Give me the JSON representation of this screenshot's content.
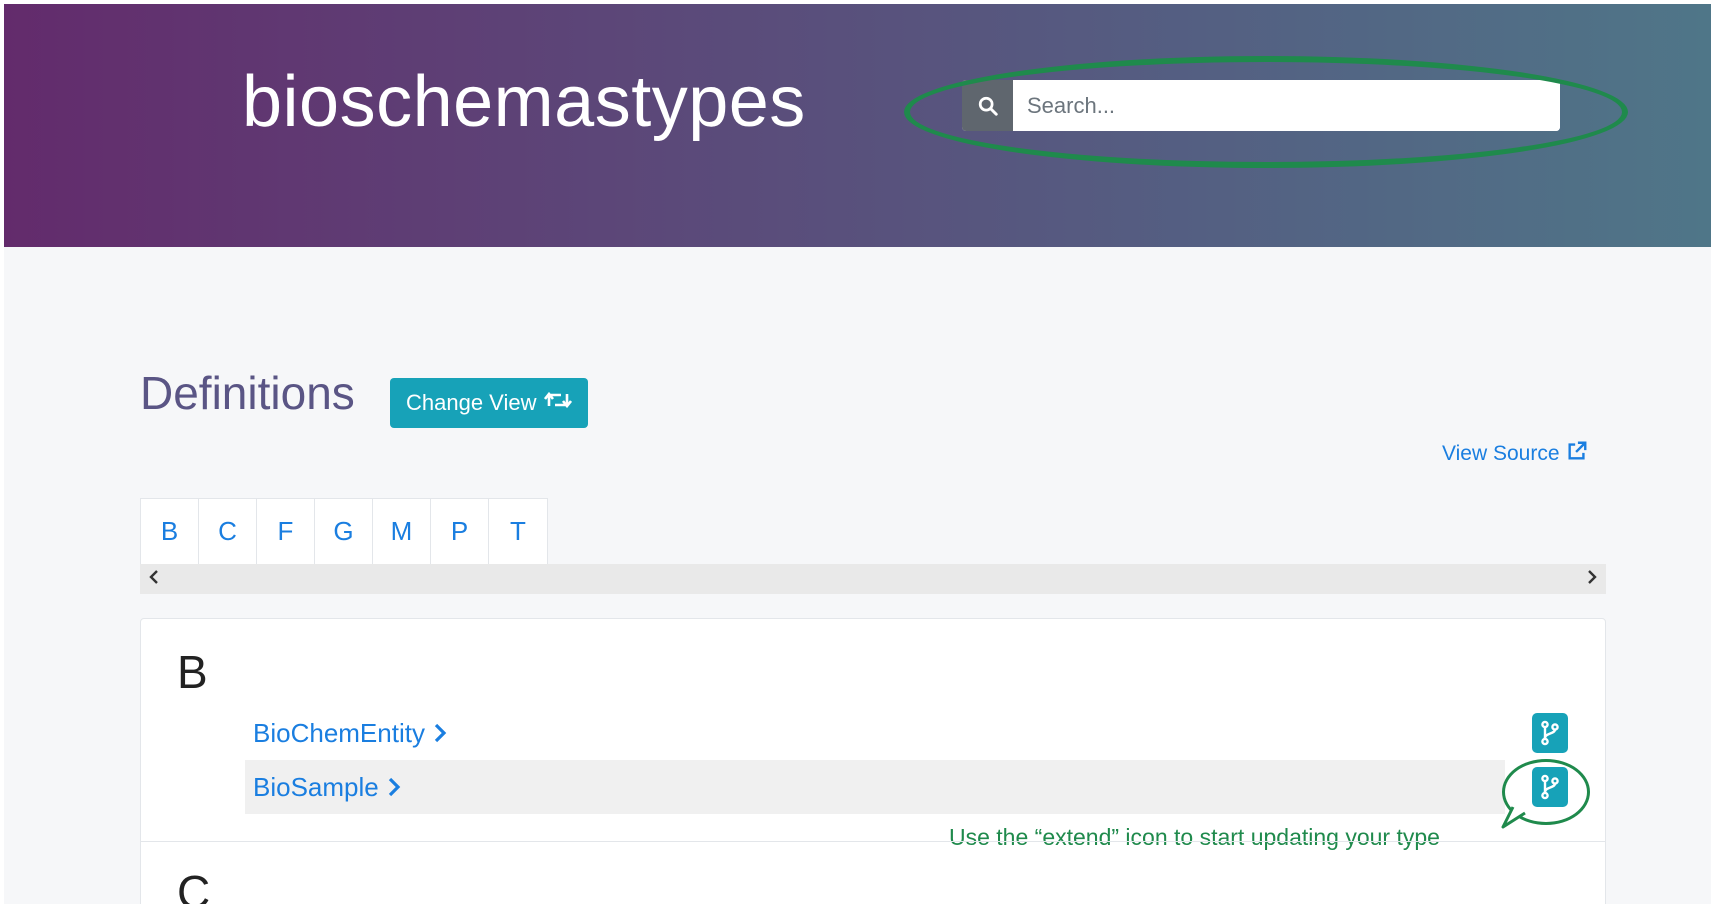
{
  "header": {
    "site_title": "bioschemastypes",
    "search": {
      "placeholder": "Search...",
      "value": ""
    }
  },
  "definitions": {
    "title": "Definitions",
    "change_view_label": "Change View",
    "view_source_label": "View Source"
  },
  "letter_tabs": [
    "B",
    "C",
    "F",
    "G",
    "M",
    "P",
    "T"
  ],
  "sections": [
    {
      "letter": "B",
      "items": [
        {
          "label": "BioChemEntity"
        },
        {
          "label": "BioSample"
        }
      ]
    },
    {
      "letter": "C",
      "items": []
    }
  ],
  "annotation": {
    "text": "Use the “extend” icon to start updating your type",
    "color": "#1f8a4c"
  },
  "colors": {
    "accent": "#17a2b8",
    "link": "#1a7ee0",
    "header_gradient_start": "#632b6c",
    "header_gradient_end": "#4f7688"
  },
  "icons": {
    "search": "search-icon",
    "change_view": "retweet-icon",
    "view_source": "external-link-icon",
    "extend": "code-branch-icon",
    "scroll_left": "chevron-left-icon",
    "scroll_right": "chevron-right-icon",
    "item_chevron": "chevron-right-icon"
  }
}
